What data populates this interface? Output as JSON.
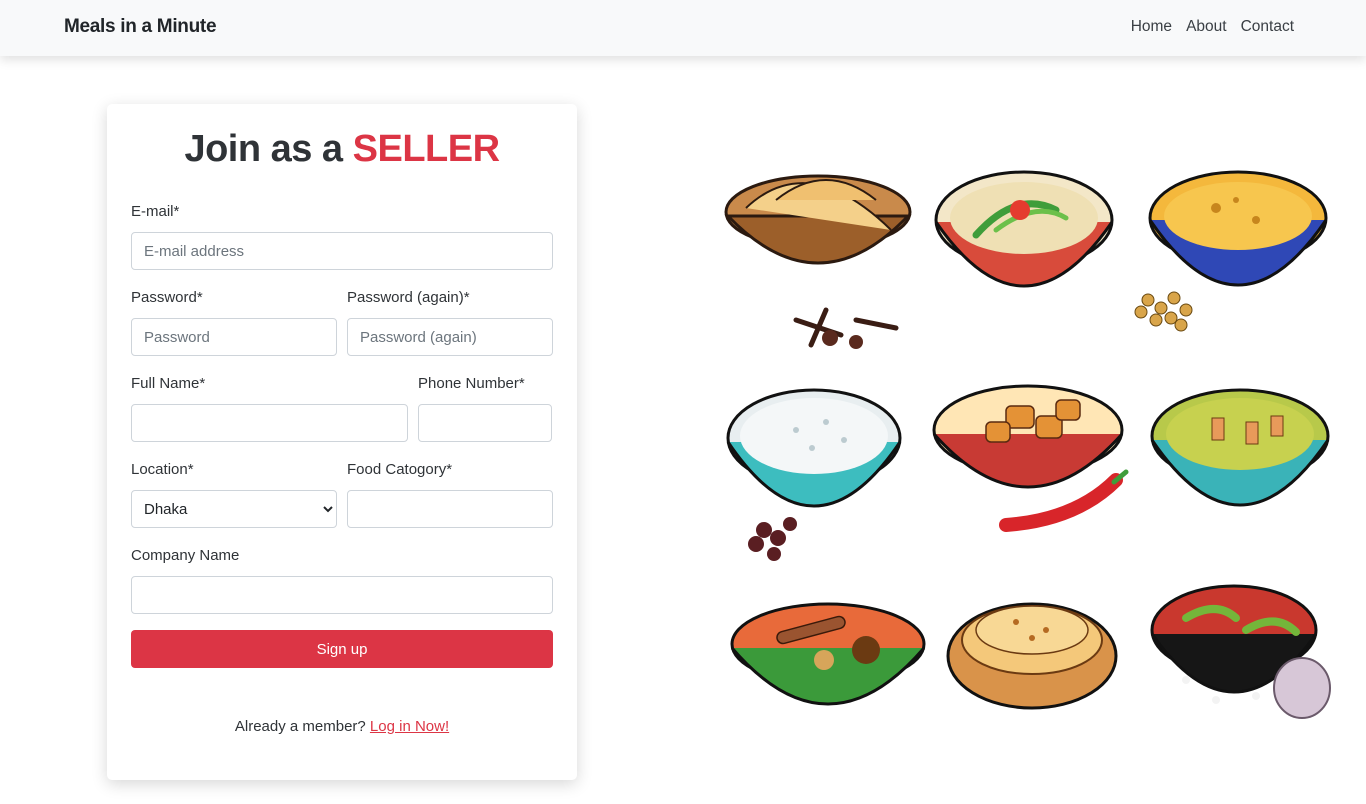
{
  "navbar": {
    "brand": "Meals in a Minute",
    "links": [
      "Home",
      "About",
      "Contact"
    ]
  },
  "form": {
    "title_prefix": "Join as a ",
    "title_accent": "SELLER",
    "email": {
      "label": "E-mail*",
      "placeholder": "E-mail address",
      "value": ""
    },
    "password": {
      "label": "Password*",
      "placeholder": "Password",
      "value": ""
    },
    "password_again": {
      "label": "Password (again)*",
      "placeholder": "Password (again)",
      "value": ""
    },
    "full_name": {
      "label": "Full Name*",
      "value": ""
    },
    "phone": {
      "label": "Phone Number*",
      "value": ""
    },
    "location": {
      "label": "Location*",
      "selected": "Dhaka"
    },
    "food_category": {
      "label": "Food Catogory*",
      "value": ""
    },
    "company": {
      "label": "Company Name",
      "value": ""
    },
    "submit_label": "Sign up",
    "member_prompt": "Already a member? ",
    "login_link": "Log in Now!"
  },
  "colors": {
    "accent": "#dc3545",
    "navbar_bg": "#f8f9fa"
  },
  "illustration": {
    "icon": "indian-food-bowls-illustration",
    "items": [
      "naan-basket",
      "curry-bowl-chili",
      "dal-bowl",
      "rice-bowl",
      "chicken-rice-bowl",
      "green-curry-bowl",
      "spiced-curry-bowl",
      "flatbread-plate",
      "red-curry-bowl"
    ]
  }
}
